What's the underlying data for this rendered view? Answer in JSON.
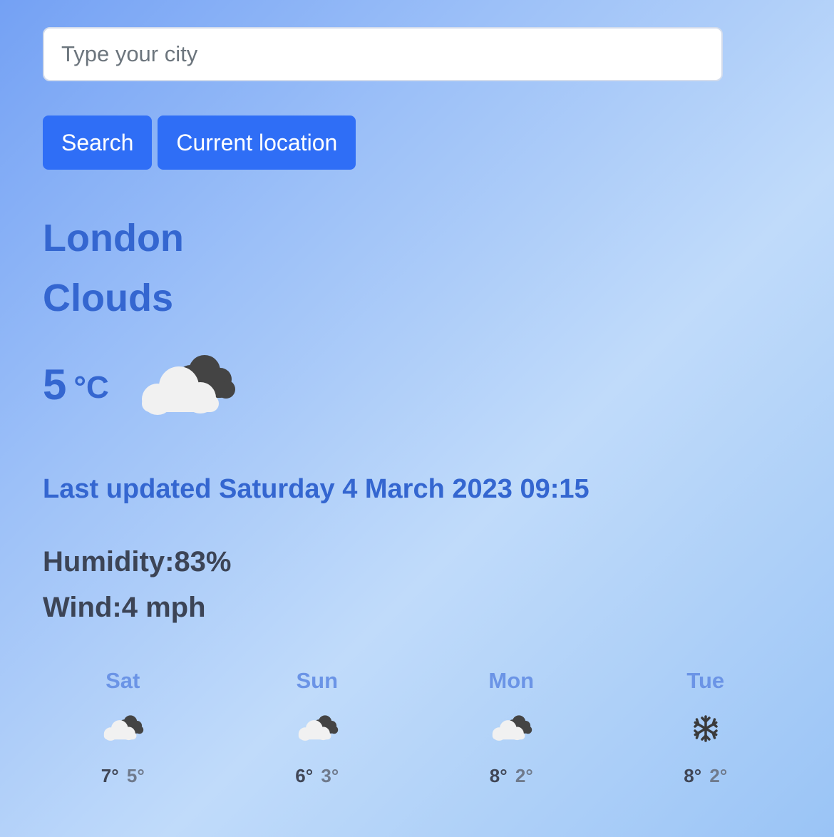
{
  "search": {
    "placeholder": "Type your city",
    "value": ""
  },
  "buttons": {
    "search_label": "Search",
    "location_label": "Current location",
    "color": "#2f6ef6"
  },
  "weather": {
    "city": "London",
    "condition": "Clouds",
    "temperature": "5",
    "unit": "°C",
    "icon": "cloudy-icon",
    "last_updated": "Last updated Saturday 4 March 2023 09:15",
    "humidity": "Humidity:83%",
    "wind": "Wind:4 mph"
  },
  "forecast": [
    {
      "day": "Sat",
      "icon": "cloudy-icon",
      "max": "7°",
      "min": "5°"
    },
    {
      "day": "Sun",
      "icon": "cloudy-icon",
      "max": "6°",
      "min": "3°"
    },
    {
      "day": "Mon",
      "icon": "cloudy-icon",
      "max": "8°",
      "min": "2°"
    },
    {
      "day": "Tue",
      "icon": "snowflake-icon",
      "max": "8°",
      "min": "2°"
    }
  ],
  "colors": {
    "accent": "#3466d0",
    "text_dark": "#3c4456",
    "forecast_day": "#6b94e6"
  }
}
